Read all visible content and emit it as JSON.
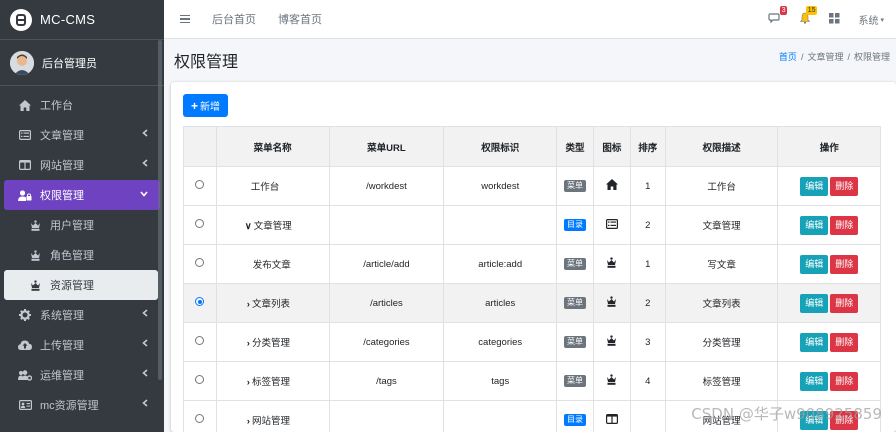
{
  "sidebar": {
    "brand": "MC-CMS",
    "user": "后台管理员",
    "items": [
      {
        "label": "工作台",
        "icon": "home-icon",
        "arrow": false
      },
      {
        "label": "文章管理",
        "icon": "list-alt-icon",
        "arrow": true
      },
      {
        "label": "网站管理",
        "icon": "columns-icon",
        "arrow": true
      },
      {
        "label": "权限管理",
        "icon": "user-lock-icon",
        "arrow": true,
        "active": true
      },
      {
        "label": "用户管理",
        "icon": "chess-icon",
        "sub": true
      },
      {
        "label": "角色管理",
        "icon": "chess-icon",
        "sub": true
      },
      {
        "label": "资源管理",
        "icon": "chess-icon",
        "sub": true,
        "current": true
      },
      {
        "label": "系统管理",
        "icon": "cog-icon",
        "arrow": true
      },
      {
        "label": "上传管理",
        "icon": "cloud-upload-icon",
        "arrow": true
      },
      {
        "label": "运维管理",
        "icon": "users-cog-icon",
        "arrow": true
      },
      {
        "label": "mc资源管理",
        "icon": "id-card-icon",
        "arrow": true
      }
    ]
  },
  "header": {
    "links": [
      "后台首页",
      "博客首页"
    ],
    "messages_badge": "3",
    "notifications_badge": "15",
    "system_menu": "系统"
  },
  "content": {
    "title": "权限管理",
    "breadcrumb": [
      "首页",
      "文章管理",
      "权限管理"
    ],
    "add_button": "新增"
  },
  "table": {
    "headers": [
      "",
      "菜单名称",
      "菜单URL",
      "权限标识",
      "类型",
      "图标",
      "排序",
      "权限描述",
      "操作"
    ],
    "edit_label": "编辑",
    "delete_label": "删除",
    "rows": [
      {
        "selected": false,
        "prefix": "",
        "name": "工作台",
        "url": "/workdest",
        "perm": "workdest",
        "type": "菜单",
        "type_kind": "menu",
        "icon": "home-icon",
        "order": "1",
        "desc": "工作台"
      },
      {
        "selected": false,
        "prefix": "∨",
        "name": "文章管理",
        "url": "",
        "perm": "",
        "type": "目录",
        "type_kind": "dir",
        "icon": "list-alt-icon",
        "order": "2",
        "desc": "文章管理"
      },
      {
        "selected": false,
        "prefix": "",
        "name": "发布文章",
        "url": "/article/add",
        "perm": "article:add",
        "type": "菜单",
        "type_kind": "menu",
        "icon": "chess-icon",
        "order": "1",
        "desc": "写文章"
      },
      {
        "selected": true,
        "prefix": "›",
        "name": "文章列表",
        "url": "/articles",
        "perm": "articles",
        "type": "菜单",
        "type_kind": "menu",
        "icon": "chess-icon",
        "order": "2",
        "desc": "文章列表"
      },
      {
        "selected": false,
        "prefix": "›",
        "name": "分类管理",
        "url": "/categories",
        "perm": "categories",
        "type": "菜单",
        "type_kind": "menu",
        "icon": "chess-icon",
        "order": "3",
        "desc": "分类管理"
      },
      {
        "selected": false,
        "prefix": "›",
        "name": "标签管理",
        "url": "/tags",
        "perm": "tags",
        "type": "菜单",
        "type_kind": "menu",
        "icon": "chess-icon",
        "order": "4",
        "desc": "标签管理"
      },
      {
        "selected": false,
        "prefix": "›",
        "name": "网站管理",
        "url": "",
        "perm": "",
        "type": "目录",
        "type_kind": "dir",
        "icon": "columns-icon",
        "order": "",
        "desc": "网站管理"
      }
    ]
  },
  "watermark": "CSDN @华子w908925859",
  "colors": {
    "sidebar_bg": "#343a40",
    "active_purple": "#6f42c1",
    "primary": "#007bff",
    "info": "#17a2b8",
    "danger": "#dc3545"
  }
}
